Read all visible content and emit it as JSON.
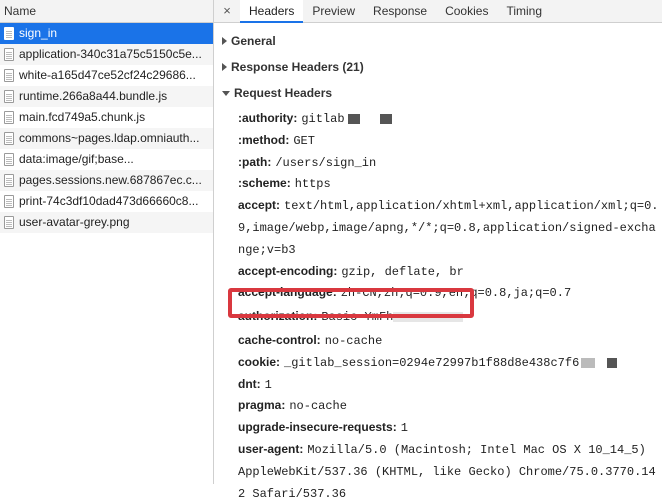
{
  "left": {
    "header": "Name",
    "files": [
      {
        "name": "sign_in",
        "selected": true
      },
      {
        "name": "application-340c31a75c5150c5e..."
      },
      {
        "name": "white-a165d47ce52cf24c29686..."
      },
      {
        "name": "runtime.266a8a44.bundle.js"
      },
      {
        "name": "main.fcd749a5.chunk.js"
      },
      {
        "name": "commons~pages.ldap.omniauth..."
      },
      {
        "name": "data:image/gif;base..."
      },
      {
        "name": "pages.sessions.new.687867ec.c..."
      },
      {
        "name": "print-74c3df10dad473d66660c8..."
      },
      {
        "name": "user-avatar-grey.png"
      }
    ]
  },
  "tabs": {
    "close": "×",
    "items": [
      "Headers",
      "Preview",
      "Response",
      "Cookies",
      "Timing"
    ],
    "active": "Headers"
  },
  "sections": {
    "general": "General",
    "response_headers": "Response Headers (21)",
    "request_headers": "Request Headers"
  },
  "request_headers": [
    {
      "name": ":authority:",
      "value": "gitlab"
    },
    {
      "name": ":method:",
      "value": "GET"
    },
    {
      "name": ":path:",
      "value": "/users/sign_in"
    },
    {
      "name": ":scheme:",
      "value": "https"
    },
    {
      "name": "accept:",
      "value": "text/html,application/xhtml+xml,application/xml;q=0.9,image/webp,image/apng,*/*;q=0.8,application/signed-exchange;v=b3"
    },
    {
      "name": "accept-encoding:",
      "value": "gzip, deflate, br"
    },
    {
      "name": "accept-language:",
      "value": "zh-CN,zh;q=0.9,en;q=0.8,ja;q=0.7"
    },
    {
      "name": "authorization:",
      "value": "Basic YmFh"
    },
    {
      "name": "cache-control:",
      "value": "no-cache"
    },
    {
      "name": "cookie:",
      "value": "_gitlab_session=0294e72997b1f88d8e438c7f6"
    },
    {
      "name": "dnt:",
      "value": "1"
    },
    {
      "name": "pragma:",
      "value": "no-cache"
    },
    {
      "name": "upgrade-insecure-requests:",
      "value": "1"
    },
    {
      "name": "user-agent:",
      "value": "Mozilla/5.0 (Macintosh; Intel Mac OS X 10_14_5) AppleWebKit/537.36 (KHTML, like Gecko) Chrome/75.0.3770.142 Safari/537.36"
    }
  ],
  "colors": {
    "selection": "#1a73e8",
    "highlight_box": "#d9383f"
  }
}
